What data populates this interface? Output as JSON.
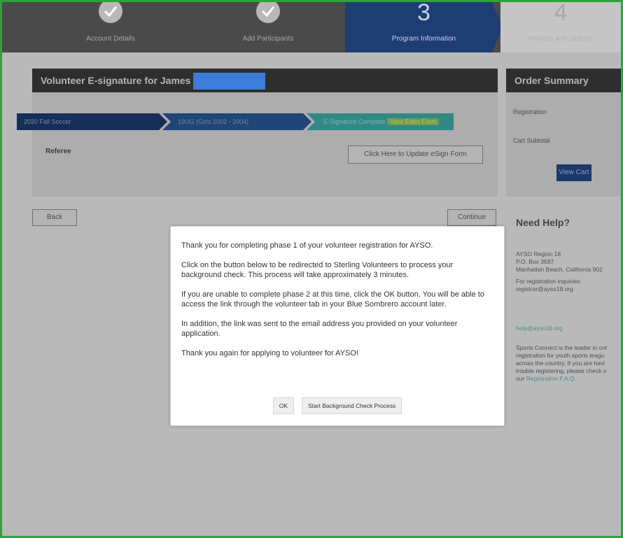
{
  "stepper": {
    "steps": [
      {
        "label": "Account Details",
        "icon": "check-icon"
      },
      {
        "label": "Add Participants",
        "icon": "check-icon"
      },
      {
        "number": "3",
        "label": "Program Information"
      },
      {
        "number": "4",
        "label": "Waivers and Options"
      }
    ]
  },
  "volunteer_panel": {
    "title": "Volunteer E-signature for  James",
    "program": "2020 Fall Soccer",
    "division": "19UG (Girls 2002 - 2004)",
    "status": "E-Signature Complete",
    "status_link": "View Eden Form",
    "role": "Referee",
    "update_button": "Click Here to Update eSign Form"
  },
  "nav": {
    "back": "Back",
    "continue": "Continue"
  },
  "order_summary": {
    "title": "Order Summary",
    "registration_label": "Registration",
    "cart_subtotal_label": "Cart Subtotal",
    "view_cart": "View Cart"
  },
  "help": {
    "title": "Need Help?",
    "org": "AYSO Region 18",
    "po_box": "P.O. Box 3597",
    "city": "Manhattan Beach, California 902",
    "inquiries_1": "For registration inquiries:",
    "inquiries_2": "registrar@ayso18.org",
    "email": "help@ayso18.org",
    "blurb_1": "Sports Connect is the leader in onl",
    "blurb_2": "registration for youth sports leagu",
    "blurb_3": "across the country. If you are havi",
    "blurb_4": "trouble registering, please check o",
    "blurb_5_prefix": "our",
    "faq_link": "Registration F.A.Q."
  },
  "modal": {
    "p1": "Thank you for completing phase 1 of your volunteer registration for AYSO.",
    "p2": "Click on the button below to be redirected to Sterling Volunteers to process your background check. This process will take approximately 3 minutes.",
    "p3": "If you are unable to complete phase 2 at this time, click the OK button. You will be able to access the link through the volunteer tab in your Blue Sombrero account later.",
    "p4": "In addition, the link was sent to the email address you provided on your volunteer application.",
    "p5": "Thank you again for applying to volunteer for AYSO!",
    "ok_button": "OK",
    "start_button": "Start Background Check Process"
  },
  "colors": {
    "frame_border": "#2fa23a",
    "active_step": "#1e3d73",
    "panel_header": "#2e2e2e",
    "redaction": "#3b7dd8",
    "status_teal": "#2f8a86"
  }
}
